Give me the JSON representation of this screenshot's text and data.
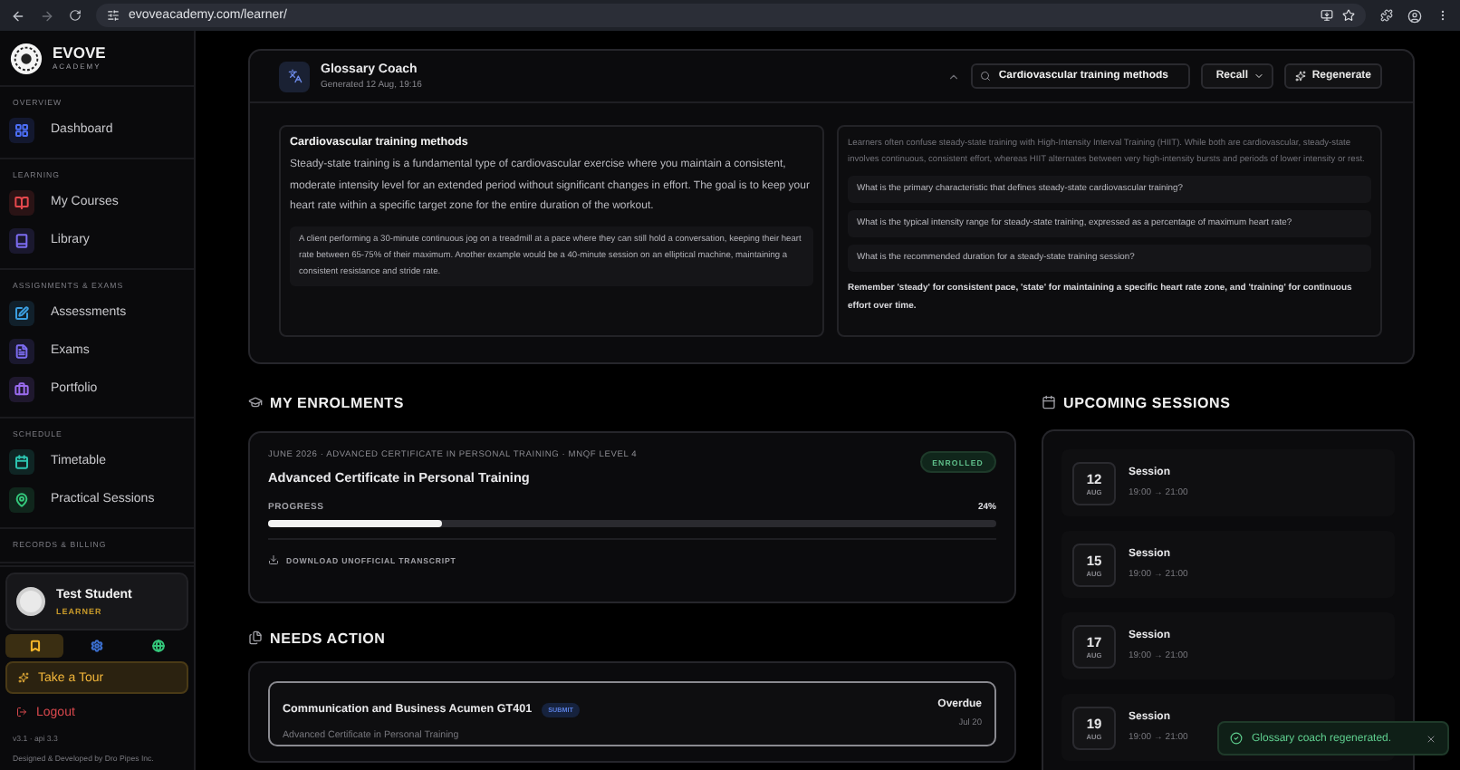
{
  "browser": {
    "url": "evoveacademy.com/learner/"
  },
  "sidebar": {
    "brand": {
      "name": "EVOVE",
      "sub": "ACADEMY"
    },
    "sections": [
      {
        "title": "OVERVIEW",
        "items": [
          {
            "label": "Dashboard",
            "kind": "grid",
            "color": "#4c6ef5"
          }
        ]
      },
      {
        "title": "LEARNING",
        "items": [
          {
            "label": "My Courses",
            "kind": "book",
            "color": "#e5484d"
          },
          {
            "label": "Library",
            "kind": "library",
            "color": "#7c6cf0"
          }
        ]
      },
      {
        "title": "ASSIGNMENTS & EXAMS",
        "items": [
          {
            "label": "Assessments",
            "kind": "edit",
            "color": "#3b9ee0"
          },
          {
            "label": "Exams",
            "kind": "file",
            "color": "#7c6cf0"
          },
          {
            "label": "Portfolio",
            "kind": "briefcase",
            "color": "#9b6cf0"
          }
        ]
      },
      {
        "title": "SCHEDULE",
        "items": [
          {
            "label": "Timetable",
            "kind": "calendar",
            "color": "#2cc4b0"
          },
          {
            "label": "Practical Sessions",
            "kind": "pin",
            "color": "#34c77b"
          }
        ]
      },
      {
        "title": "RECORDS & BILLING"
      }
    ],
    "profile": {
      "name": "Test Student",
      "role": "LEARNER"
    },
    "profile_tabs": [
      {
        "kind": "bookmark",
        "color": "#f5b62a",
        "selected": true
      },
      {
        "kind": "gear",
        "color": "#3b6fd0",
        "selected": false
      },
      {
        "kind": "globe",
        "color": "#34c77b",
        "selected": false
      }
    ],
    "tour": "Take a Tour",
    "logout": "Logout",
    "version": "v3.1 · api 3.3",
    "credit": "Designed & Developed by Dro Pipes Inc."
  },
  "glossary": {
    "title": "Glossary Coach",
    "generated": "Generated 12 Aug, 19:16",
    "search": "Cardiovascular training methods",
    "mode": "Recall",
    "regenerate": "Regenerate",
    "definition": {
      "title": "Cardiovascular training methods",
      "text": "Steady-state training is a fundamental type of cardiovascular exercise where you maintain a consistent, moderate intensity level for an extended period without significant changes in effort. The goal is to keep your heart rate within a specific target zone for the entire duration of the workout.",
      "example": "A client performing a 30-minute continuous jog on a treadmill at a pace where they can still hold a conversation, keeping their heart rate between 65-75% of their maximum. Another example would be a 40-minute session on an elliptical machine, maintaining a consistent resistance and stride rate."
    },
    "note": "Learners often confuse steady-state training with High-Intensity Interval Training (HIIT). While both are cardiovascular, steady-state involves continuous, consistent effort, whereas HIIT alternates between very high-intensity bursts and periods of lower intensity or rest.",
    "questions": [
      "What is the primary characteristic that defines steady-state cardiovascular training?",
      "What is the typical intensity range for steady-state training, expressed as a percentage of maximum heart rate?",
      "What is the recommended duration for a steady-state training session?"
    ],
    "mnemonic": "Remember 'steady' for consistent pace, 'state' for maintaining a specific heart rate zone, and 'training' for continuous effort over time."
  },
  "enrolments": {
    "heading": "MY ENROLMENTS",
    "meta": "JUNE 2026 · ADVANCED CERTIFICATE IN PERSONAL TRAINING · MNQF LEVEL 4",
    "title": "Advanced Certificate in Personal Training",
    "badge": "ENROLLED",
    "progress_label": "PROGRESS",
    "percent": "24%",
    "level": 0.24,
    "download": "DOWNLOAD UNOFFICIAL TRANSCRIPT"
  },
  "needs_action": {
    "heading": "NEEDS ACTION",
    "items": [
      {
        "title": "Communication and Business Acumen GT401",
        "tag": "SUBMIT",
        "subtitle": "Advanced Certificate in Personal Training",
        "status": "Overdue",
        "date": "Jul 20"
      }
    ]
  },
  "sessions": {
    "heading": "UPCOMING SESSIONS",
    "items": [
      {
        "day": "12",
        "month": "AUG",
        "title": "Session",
        "time": "19:00 → 21:00"
      },
      {
        "day": "15",
        "month": "AUG",
        "title": "Session",
        "time": "19:00 → 21:00"
      },
      {
        "day": "17",
        "month": "AUG",
        "title": "Session",
        "time": "19:00 → 21:00"
      },
      {
        "day": "19",
        "month": "AUG",
        "title": "Session",
        "time": "19:00 → 21:00"
      }
    ]
  },
  "toast": {
    "text": "Glossary coach regenerated."
  }
}
